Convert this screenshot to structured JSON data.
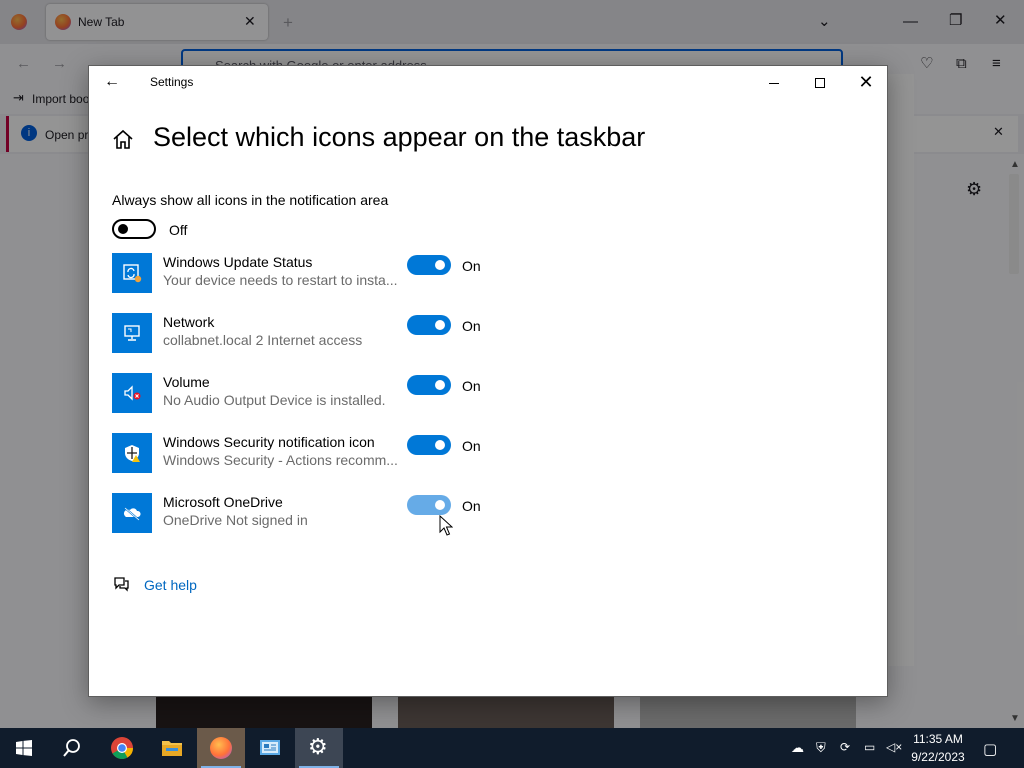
{
  "browser": {
    "tab_title": "New Tab",
    "url_placeholder": "Search with Google or enter address",
    "bookmark_import": "Import boo",
    "info_text": "Open pr"
  },
  "settings": {
    "window_title": "Settings",
    "page_title": "Select which icons appear on the taskbar",
    "always_show_label": "Always show all icons in the notification area",
    "always_show_state": "Off",
    "items": [
      {
        "title": "Windows Update Status",
        "subtitle": "Your device needs to restart to insta...",
        "state": "On",
        "icon": "windows-update-icon"
      },
      {
        "title": "Network",
        "subtitle": "collabnet.local 2 Internet access",
        "state": "On",
        "icon": "network-icon"
      },
      {
        "title": "Volume",
        "subtitle": "No Audio Output Device is installed.",
        "state": "On",
        "icon": "volume-muted-icon"
      },
      {
        "title": "Windows Security notification icon",
        "subtitle": "Windows Security - Actions recomm...",
        "state": "On",
        "icon": "windows-security-icon"
      },
      {
        "title": "Microsoft OneDrive",
        "subtitle": "OneDrive Not signed in",
        "state": "On",
        "icon": "onedrive-icon"
      }
    ],
    "help_link": "Get help",
    "accent": "#0078d7"
  },
  "taskbar": {
    "time": "11:35 AM",
    "date": "9/22/2023",
    "apps": [
      "start-icon",
      "search-icon",
      "chrome-icon",
      "file-explorer-icon",
      "firefox-icon",
      "control-panel-icon",
      "settings-icon"
    ]
  }
}
